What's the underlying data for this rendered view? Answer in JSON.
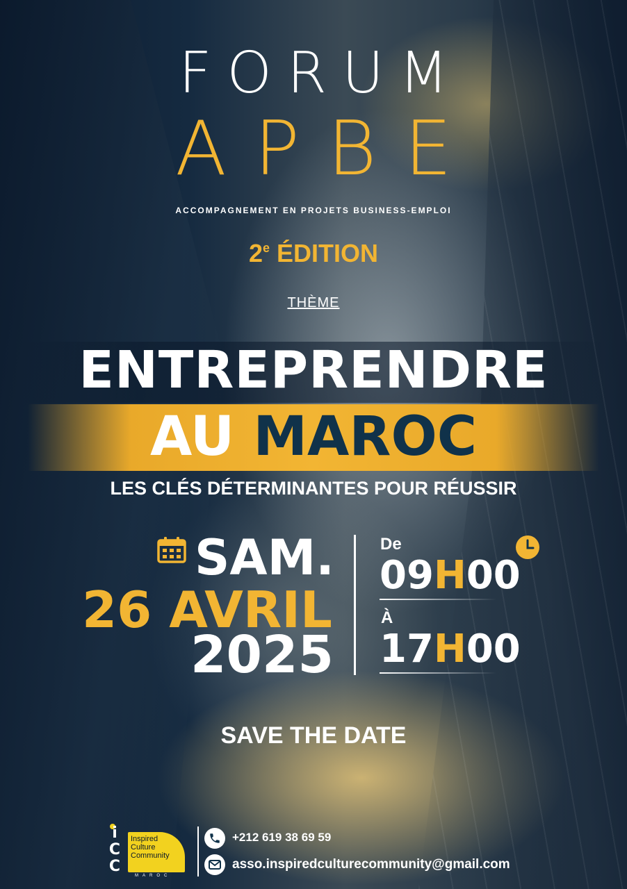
{
  "header": {
    "line1": "FORUM",
    "line2": "APBE",
    "subtitle": "ACCOMPAGNEMENT EN PROJETS BUSINESS-EMPLOI",
    "edition_number": "2",
    "edition_suffix": "e",
    "edition_word": "ÉDITION"
  },
  "theme": {
    "label": "THÈME",
    "line1": "ENTREPRENDRE",
    "line2_white": "AU",
    "line2_dark": "MAROC",
    "tagline": "LES CLÉS DÉTERMINANTES POUR RÉUSSIR"
  },
  "date": {
    "weekday": "SAM.",
    "day_month": "26 AVRIL",
    "year": "2025"
  },
  "time": {
    "from_label": "De",
    "start_hour": "09",
    "start_h": "H",
    "start_min": "00",
    "to_label": "À",
    "end_hour": "17",
    "end_h": "H",
    "end_min": "00"
  },
  "cta": "SAVE THE DATE",
  "organizer": {
    "logo_letters": [
      "i",
      "C",
      "C"
    ],
    "logo_text": [
      "Inspired",
      "Culture",
      "Community"
    ],
    "logo_country": "MAROC"
  },
  "contact": {
    "phone": "+212 619 38 69 59",
    "email": "asso.inspiredculturecommunity@gmail.com",
    "phone_icon": "phone-icon",
    "email_icon": "envelope-icon"
  },
  "colors": {
    "gold": "#f2b533",
    "navy": "#10324a",
    "white": "#ffffff",
    "logo_yellow": "#f2d21f"
  }
}
